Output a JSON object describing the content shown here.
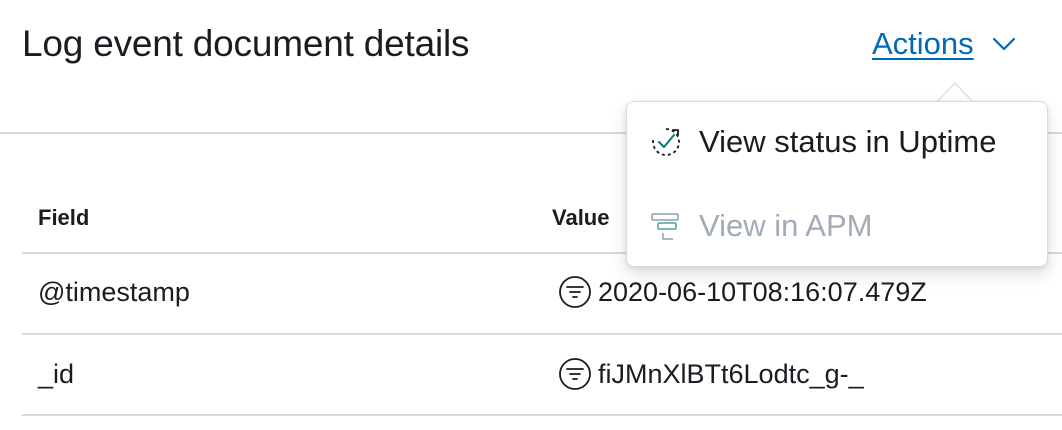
{
  "header": {
    "title": "Log event document details",
    "actions_label": "Actions"
  },
  "table": {
    "columns": [
      "Field",
      "Value"
    ],
    "rows": [
      {
        "field": "@timestamp",
        "value": "2020-06-10T08:16:07.479Z"
      },
      {
        "field": "_id",
        "value": "fiJMnXlBTt6Lodtc_g-_"
      }
    ]
  },
  "actions_menu": {
    "items": [
      {
        "label": "View status in Uptime",
        "icon": "uptime-icon",
        "enabled": true
      },
      {
        "label": "View in APM",
        "icon": "apm-icon",
        "enabled": false
      }
    ]
  },
  "colors": {
    "link": "#006bb4",
    "text": "#1a1c21",
    "disabled": "#a2abba",
    "border": "#d3dae6",
    "icon_accent": "#017d73"
  }
}
